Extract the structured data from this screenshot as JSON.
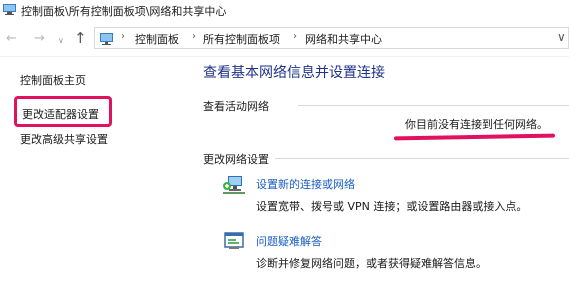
{
  "window": {
    "title": "控制面板\\所有控制面板项\\网络和共享中心"
  },
  "nav": {
    "back_glyph": "←",
    "forward_glyph": "→",
    "recent_glyph": "∨",
    "up_glyph": "↑",
    "breadcrumb": [
      "控制面板",
      "所有控制面板项",
      "网络和共享中心"
    ],
    "separator": "›",
    "dropdown_glyph": "∨"
  },
  "sidebar": {
    "items": [
      {
        "label": "控制面板主页"
      },
      {
        "label": "更改适配器设置"
      },
      {
        "label": "更改高级共享设置"
      }
    ]
  },
  "main": {
    "title": "查看基本网络信息并设置连接",
    "active_section": {
      "label": "查看活动网络",
      "status": "你目前没有连接到任何网络。"
    },
    "change_section": {
      "label": "更改网络设置",
      "items": [
        {
          "icon": "network-setup-icon",
          "link": "设置新的连接或网络",
          "desc": "设置宽带、拨号或 VPN 连接；或设置路由器或接入点。"
        },
        {
          "icon": "troubleshoot-icon",
          "link": "问题疑难解答",
          "desc": "诊断并修复网络问题，或者获得疑难解答信息。"
        }
      ]
    }
  },
  "colors": {
    "annotation": "#e0115f",
    "heading": "#1e3287",
    "link": "#1a5cc4"
  }
}
